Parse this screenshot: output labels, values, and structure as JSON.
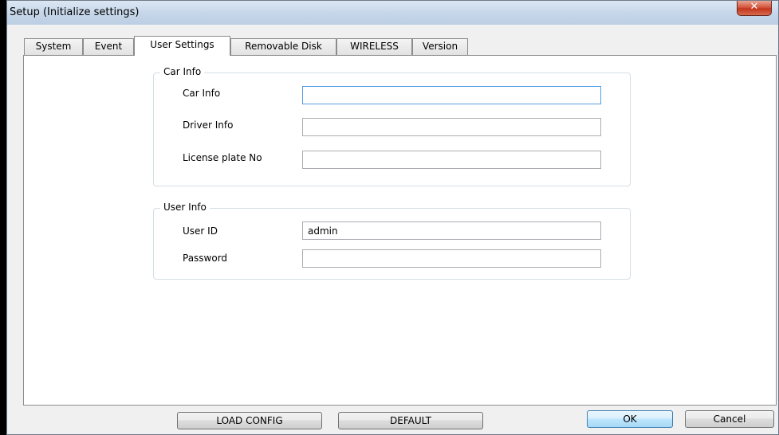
{
  "window": {
    "title": "Setup (Initialize settings)",
    "close_glyph": "✕"
  },
  "tabs": [
    {
      "label": "System",
      "active": false
    },
    {
      "label": "Event",
      "active": false
    },
    {
      "label": "User Settings",
      "active": true
    },
    {
      "label": "Removable Disk",
      "active": false
    },
    {
      "label": "WIRELESS",
      "active": false
    },
    {
      "label": "Version",
      "active": false
    }
  ],
  "car_info": {
    "group_title": "Car Info",
    "car_info_label": "Car Info",
    "car_info_value": "",
    "driver_info_label": "Driver Info",
    "driver_info_value": "",
    "license_plate_label": "License plate No",
    "license_plate_value": ""
  },
  "user_info": {
    "group_title": "User Info",
    "user_id_label": "User ID",
    "user_id_value": "admin",
    "password_label": "Password",
    "password_value": ""
  },
  "buttons": {
    "load_config": "LOAD CONFIG",
    "default": "DEFAULT",
    "ok": "OK",
    "cancel": "Cancel"
  }
}
